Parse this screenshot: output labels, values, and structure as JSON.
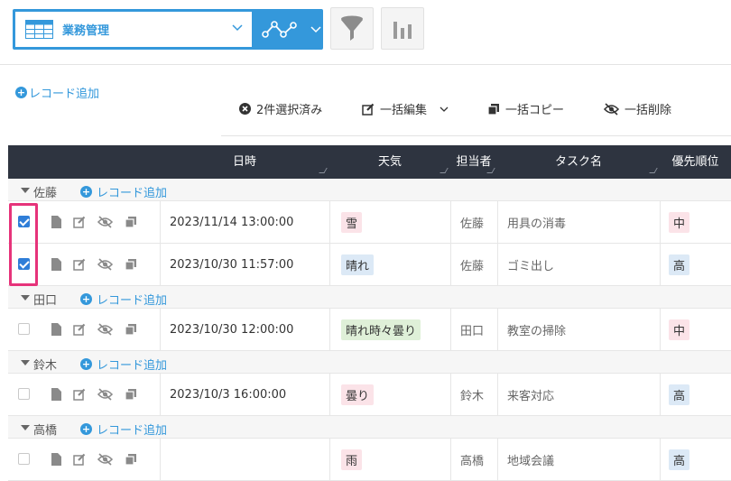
{
  "toolbar": {
    "view_name": "業務管理",
    "view_icon": "table-icon",
    "graph_icon": "line-graph-icon",
    "filter_icon": "funnel-icon",
    "chart_icon": "bar-chart-icon",
    "accent": "#3498db"
  },
  "add_record_label": "レコード追加",
  "actions": {
    "selected": "2件選択済み",
    "bulk_edit": "一括編集",
    "bulk_copy": "一括コピー",
    "bulk_delete": "一括削除"
  },
  "table": {
    "columns": [
      "日時",
      "天気",
      "担当者",
      "タスク名",
      "優先順位"
    ],
    "groups": [
      {
        "name": "佐藤",
        "add": "レコード追加"
      },
      {
        "name": "田口",
        "add": "レコード追加"
      },
      {
        "name": "鈴木",
        "add": "レコード追加"
      },
      {
        "name": "高橋",
        "add": "レコード追加"
      }
    ],
    "rows": [
      {
        "checked": true,
        "datetime": "2023/11/14 13:00:00",
        "weather": "雪",
        "assignee": "佐藤",
        "task": "用具の消毒",
        "priority": "中"
      },
      {
        "checked": true,
        "datetime": "2023/10/30 11:57:00",
        "weather": "晴れ",
        "assignee": "佐藤",
        "task": "ゴミ出し",
        "priority": "高"
      },
      {
        "checked": false,
        "datetime": "2023/10/30 12:00:00",
        "weather": "晴れ時々曇り",
        "assignee": "田口",
        "task": "教室の掃除",
        "priority": "中"
      },
      {
        "checked": false,
        "datetime": "2023/10/3 16:00:00",
        "weather": "曇り",
        "assignee": "鈴木",
        "task": "来客対応",
        "priority": "高"
      },
      {
        "checked": false,
        "datetime": "",
        "weather": "雨",
        "assignee": "高橋",
        "task": "地域会議",
        "priority": "高"
      }
    ]
  },
  "colors": {
    "weather_snow": "#fbe3e8",
    "weather_sunny": "#dce9f6",
    "weather_mixed": "#dff0d8",
    "weather_cloudy": "#fbe3e8",
    "priority_mid": "#fbe3e8",
    "priority_high": "#dce9f6",
    "selection_highlight": "#e6337a"
  }
}
